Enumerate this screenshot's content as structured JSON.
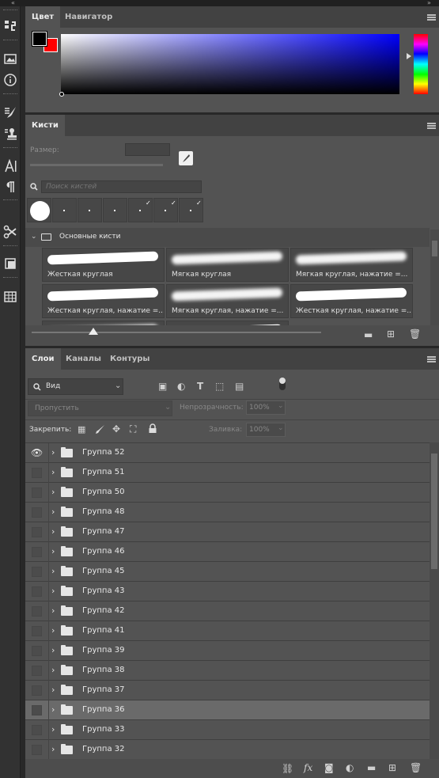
{
  "colors": {
    "foreground": "#000000",
    "background": "#ff0000",
    "accent_selected_row": "#6a6a6a"
  },
  "color_panel": {
    "tabs": [
      {
        "label": "Цвет"
      },
      {
        "label": "Навигатор"
      }
    ]
  },
  "brushes_panel": {
    "tab": "Кисти",
    "size_label": "Размер:",
    "search_placeholder": "Поиск кистей",
    "group_name": "Основные кисти",
    "presets": [
      {
        "label": "Жесткая круглая"
      },
      {
        "label": "Мягкая круглая"
      },
      {
        "label": "Мягкая круглая, нажатие =..."
      },
      {
        "label": "Жесткая круглая, нажатие =..."
      },
      {
        "label": "Мягкая круглая, нажатие =..."
      },
      {
        "label": "Жесткая круглая, нажатие =..."
      }
    ]
  },
  "layers_panel": {
    "tabs": [
      {
        "label": "Слои"
      },
      {
        "label": "Каналы"
      },
      {
        "label": "Контуры"
      }
    ],
    "filter_value": "Вид",
    "blend_mode": "Пропустить",
    "opacity_label": "Непрозрачность:",
    "opacity_value": "100%",
    "lock_label": "Закрепить:",
    "fill_label": "Заливка:",
    "fill_value": "100%",
    "layers": [
      {
        "name": "Группа 52"
      },
      {
        "name": "Группа 51"
      },
      {
        "name": "Группа 50"
      },
      {
        "name": "Группа 48"
      },
      {
        "name": "Группа 47"
      },
      {
        "name": "Группа 46"
      },
      {
        "name": "Группа 45"
      },
      {
        "name": "Группа 43"
      },
      {
        "name": "Группа 42"
      },
      {
        "name": "Группа 41"
      },
      {
        "name": "Группа 39"
      },
      {
        "name": "Группа 38"
      },
      {
        "name": "Группа 37"
      },
      {
        "name": "Группа 36"
      },
      {
        "name": "Группа 33"
      },
      {
        "name": "Группа 32"
      }
    ],
    "selected_layer": "Группа 36",
    "visible_layer": "Группа 52"
  }
}
